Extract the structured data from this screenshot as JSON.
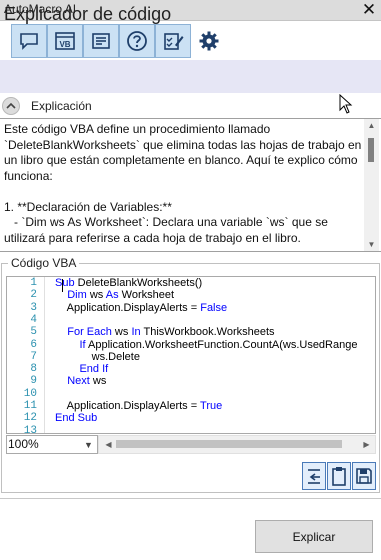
{
  "window": {
    "title": "AutoMacro AI",
    "close_glyph": "✕"
  },
  "toolbar": {
    "buttons": [
      {
        "name": "chat-icon"
      },
      {
        "name": "vba-icon",
        "text": "VB"
      },
      {
        "name": "document-icon"
      },
      {
        "name": "help-icon"
      },
      {
        "name": "edit-checklist-icon"
      },
      {
        "name": "gear-icon"
      }
    ],
    "selected_index": 5
  },
  "header": {
    "title": "Explicador de código"
  },
  "explanation": {
    "label": "Explicación",
    "text": "Este código VBA define un procedimiento llamado `DeleteBlankWorksheets` que elimina todas las hojas de trabajo en un libro que están completamente en blanco. Aquí te explico cómo funciona:\n\n1. **Declaración de Variables:**\n   - `Dim ws As Worksheet`: Declara una variable `ws` que se utilizará para referirse a cada hoja de trabajo en el libro."
  },
  "code_section": {
    "label": "Código VBA",
    "lines": [
      {
        "n": "1",
        "parts": [
          [
            "kw",
            "Sub"
          ],
          [
            "",
            " DeleteBlankWorksheets()"
          ]
        ]
      },
      {
        "n": "2",
        "parts": [
          [
            "",
            "    "
          ],
          [
            "kw",
            "Dim"
          ],
          [
            "",
            " ws "
          ],
          [
            "kw",
            "As"
          ],
          [
            "",
            " Worksheet"
          ]
        ]
      },
      {
        "n": "3",
        "parts": [
          [
            "",
            "    Application.DisplayAlerts = "
          ],
          [
            "kw",
            "False"
          ]
        ]
      },
      {
        "n": "4",
        "parts": []
      },
      {
        "n": "5",
        "parts": [
          [
            "",
            "    "
          ],
          [
            "kw",
            "For Each"
          ],
          [
            "",
            " ws "
          ],
          [
            "kw",
            "In"
          ],
          [
            "",
            " ThisWorkbook.Worksheets"
          ]
        ]
      },
      {
        "n": "6",
        "parts": [
          [
            "",
            "        "
          ],
          [
            "kw",
            "If"
          ],
          [
            "",
            " Application.WorksheetFunction.CountA(ws.UsedRange"
          ]
        ]
      },
      {
        "n": "7",
        "parts": [
          [
            "",
            "            ws.Delete"
          ]
        ]
      },
      {
        "n": "8",
        "parts": [
          [
            "",
            "        "
          ],
          [
            "kw",
            "End If"
          ]
        ]
      },
      {
        "n": "9",
        "parts": [
          [
            "",
            "    "
          ],
          [
            "kw",
            "Next"
          ],
          [
            "",
            " ws"
          ]
        ]
      },
      {
        "n": "10",
        "parts": []
      },
      {
        "n": "11",
        "parts": [
          [
            "",
            "    Application.DisplayAlerts = "
          ],
          [
            "kw",
            "True"
          ]
        ]
      },
      {
        "n": "12",
        "parts": [
          [
            "kw",
            "End Sub"
          ]
        ]
      },
      {
        "n": "13",
        "parts": []
      }
    ],
    "zoom": "100%"
  },
  "actions": {
    "icons": [
      {
        "name": "insert-code-icon"
      },
      {
        "name": "clipboard-icon"
      },
      {
        "name": "save-icon"
      }
    ],
    "explain_label": "Explicar"
  },
  "colors": {
    "keyword": "#0000ff",
    "line_number": "#2b91af",
    "toolbar_button": "#cbe1f4",
    "header_bg": "#e6e6f5"
  }
}
